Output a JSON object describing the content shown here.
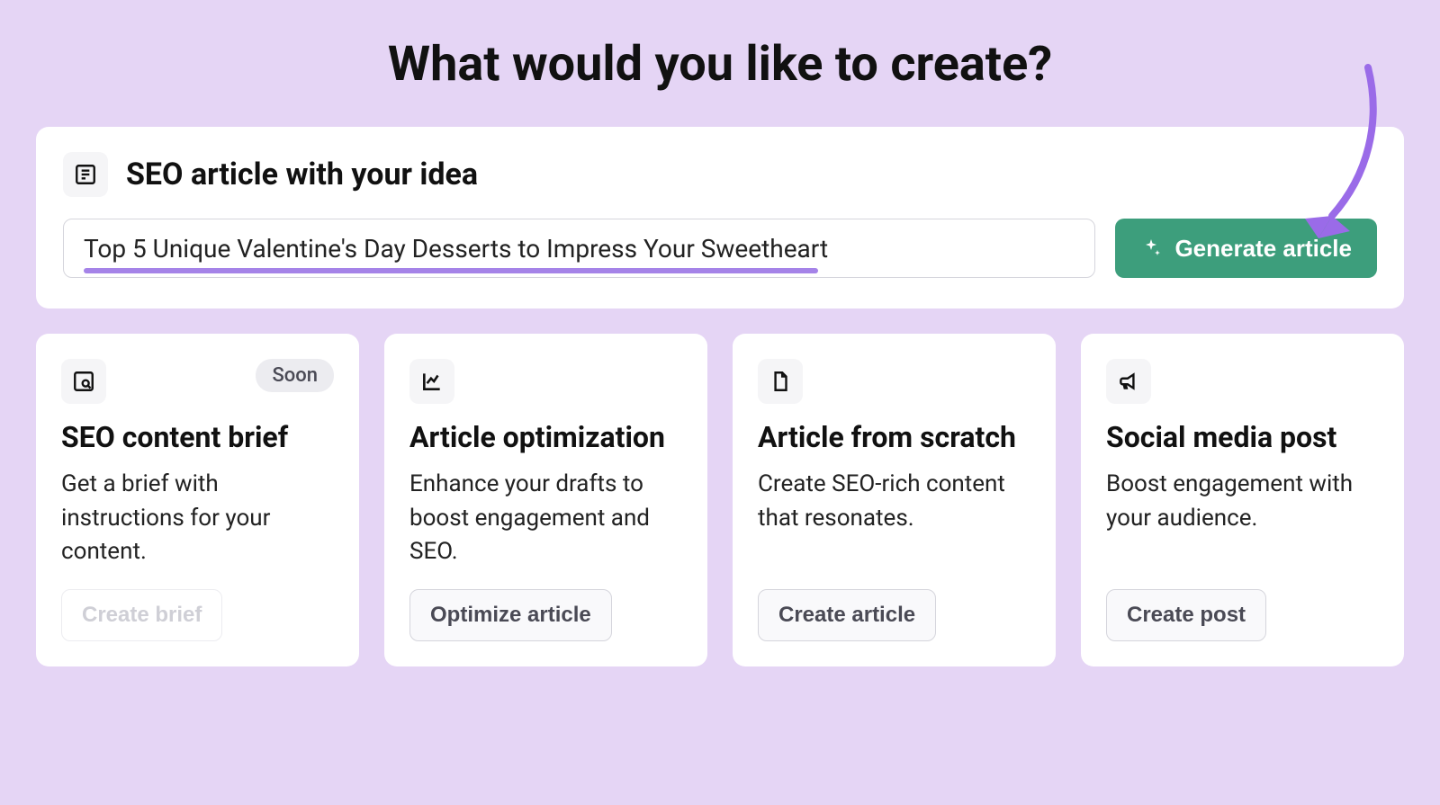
{
  "page_title": "What would you like to create?",
  "main_card": {
    "title": "SEO article with your idea",
    "input_value": "Top 5 Unique Valentine's Day Desserts to Impress Your Sweetheart",
    "generate_button_label": "Generate article"
  },
  "option_cards": [
    {
      "title": "SEO content brief",
      "description": "Get a brief with instructions for your content.",
      "button_label": "Create brief",
      "soon_label": "Soon",
      "disabled": true
    },
    {
      "title": "Article optimization",
      "description": "Enhance your drafts to boost engagement and SEO.",
      "button_label": "Optimize article",
      "disabled": false
    },
    {
      "title": "Article from scratch",
      "description": "Create SEO-rich content that resonates.",
      "button_label": "Create article",
      "disabled": false
    },
    {
      "title": "Social media post",
      "description": "Boost engagement with your audience.",
      "button_label": "Create post",
      "disabled": false
    }
  ]
}
